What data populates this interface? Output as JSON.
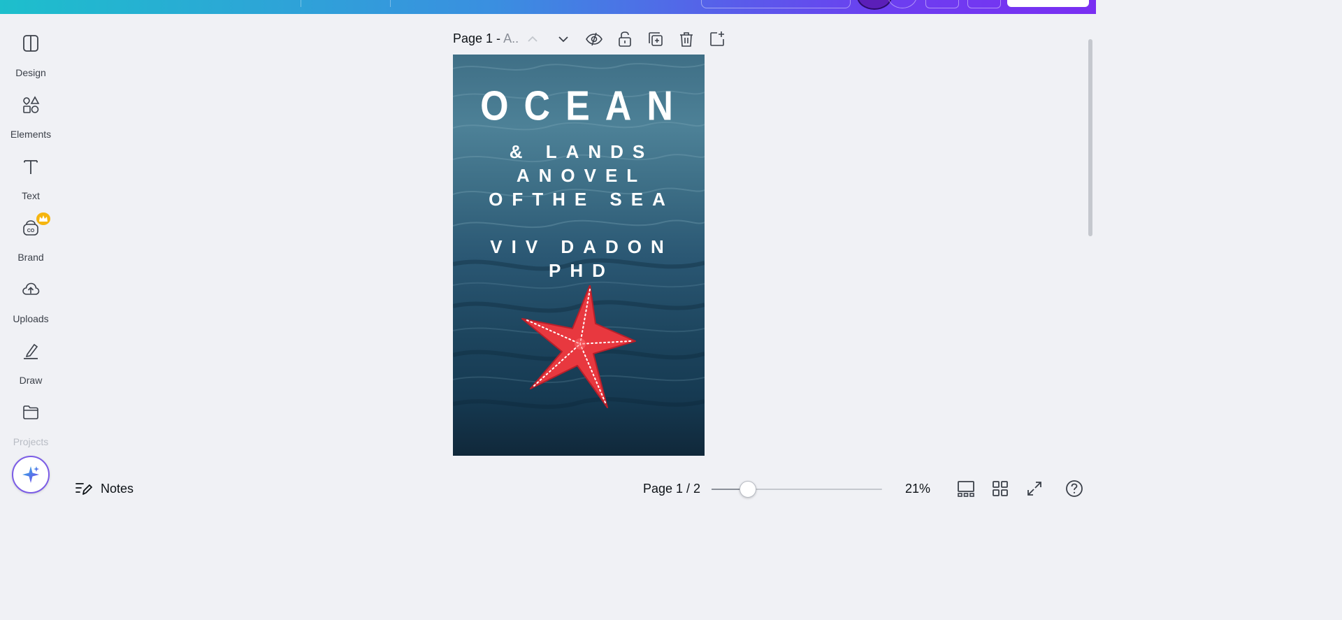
{
  "sidebar": {
    "items": [
      {
        "label": "Design",
        "icon": "design-icon"
      },
      {
        "label": "Elements",
        "icon": "elements-icon"
      },
      {
        "label": "Text",
        "icon": "text-icon"
      },
      {
        "label": "Brand",
        "icon": "brand-icon"
      },
      {
        "label": "Uploads",
        "icon": "uploads-icon"
      },
      {
        "label": "Draw",
        "icon": "draw-icon"
      },
      {
        "label": "Projects",
        "icon": "projects-icon"
      }
    ]
  },
  "page_header": {
    "title": "Page 1 - ",
    "subtitle": "A.."
  },
  "cover": {
    "title": "OCEAN",
    "subtitle_lines": [
      "& LANDS",
      "ANOVEL",
      "OFTHE SEA"
    ],
    "author_lines": [
      "VIV DADON",
      "PHD"
    ]
  },
  "bottombar": {
    "notes_label": "Notes",
    "page_count": "Page 1 / 2",
    "zoom_label": "21%",
    "zoom_fraction": 0.21
  },
  "colors": {
    "accent": "#7b5ce6",
    "gradient_start": "#1dbfcc",
    "gradient_end": "#7a2ff2",
    "crown": "#f5b50f",
    "starfish": "#e8383f"
  }
}
